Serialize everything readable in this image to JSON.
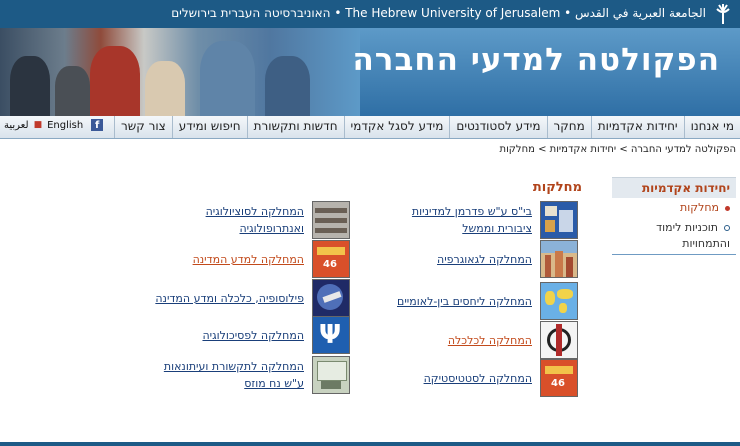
{
  "header": {
    "university": "האוניברסיטה העברית בירושלים • The Hebrew University of Jerusalem • الجامعة العبرية في القدس",
    "faculty_title": "הפקולטה למדעי החברה"
  },
  "nav": {
    "items": [
      "מי אנחנו",
      "יחידות אקדמיות",
      "מחקר",
      "מידע לסטודנטים",
      "מידע לסגל אקדמי",
      "חדשות ותקשורת",
      "חיפוש ומידע",
      "צור קשר"
    ],
    "lang_en": "English",
    "lang_ar": "لعربية"
  },
  "breadcrumb": "הפקולטה למדעי החברה > יחידות אקדמיות > מחלקות",
  "sidebar": {
    "title": "יחידות אקדמיות",
    "items": [
      "מחלקות",
      "תוכניות לימוד והתמחויות"
    ]
  },
  "main": {
    "title": "מחלקות",
    "right_column": [
      "בי\"ס ע\"ש פדרמן למדיניות ציבורית וממשל",
      "המחלקה לגאוגרפיה",
      "המחלקה ליחסים בין-לאומיים",
      "המחלקה לכלכלה",
      "המחלקה לסטטיסטיקה"
    ],
    "left_column": [
      "המחלקה לסוציולוגיה ואנתרופולוגיה",
      "המחלקה למדע המדינה",
      "פילוסופיה, כלכלה ומדע המדינה",
      "המחלקה לפסיכולוגיה",
      "המחלקה לתקשורת ועיתונאות ע\"ש נח מוזס"
    ],
    "badge_number": "46"
  },
  "colors": {
    "header_blue": "#1d5a86",
    "accent_orange": "#b1441b",
    "link_blue": "#1a3f7a"
  }
}
